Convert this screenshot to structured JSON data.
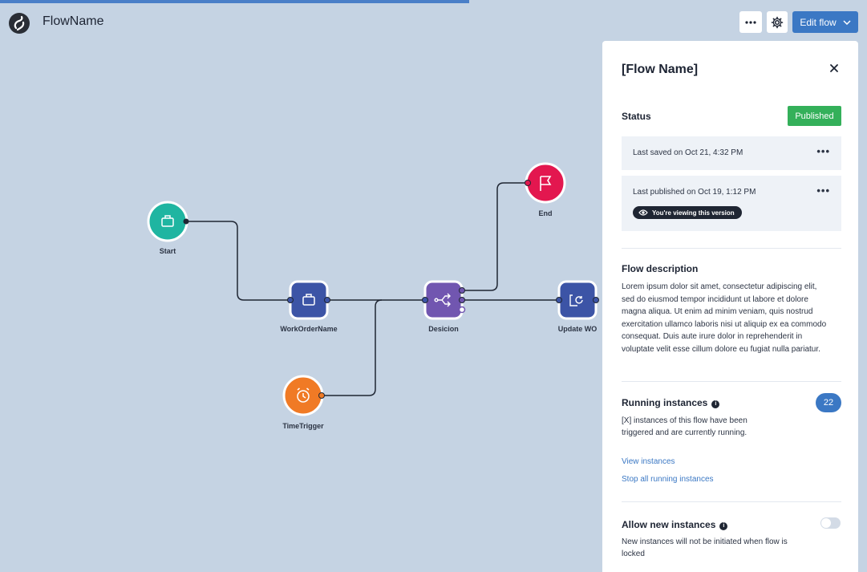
{
  "app": {
    "title": "FlowName"
  },
  "header": {
    "edit_label": "Edit flow"
  },
  "colors": {
    "canvas_bg": "#c5d3e3",
    "accent": "#3b78c4",
    "start": "#1fb5a1",
    "task": "#3c54a6",
    "decision": "#7156b0",
    "end": "#e3174f",
    "timer": "#f07a25",
    "published": "#34b05a"
  },
  "flow": {
    "nodes": {
      "start": {
        "label": "Start",
        "icon": "briefcase-icon"
      },
      "workorder": {
        "label": "WorkOrderName",
        "icon": "briefcase-icon"
      },
      "decision": {
        "label": "Desicion",
        "icon": "split-arrows-icon"
      },
      "update": {
        "label": "Update WO",
        "icon": "refresh-document-icon"
      },
      "end": {
        "label": "End",
        "icon": "flag-icon"
      },
      "timer": {
        "label": "TimeTrigger",
        "icon": "alarm-clock-icon"
      }
    }
  },
  "panel": {
    "title": "[Flow Name]",
    "status_label": "Status",
    "status_badge": "Published",
    "last_saved": "Last saved on Oct 21, 4:32 PM",
    "last_published": "Last published on Oct 19, 1:12 PM",
    "viewing_badge": "You're viewing this version",
    "description_title": "Flow description",
    "description": "Lorem ipsum dolor sit amet, consectetur adipiscing elit, sed do eiusmod tempor incididunt ut labore et dolore magna aliqua. Ut enim ad minim veniam, quis nostrud exercitation ullamco laboris nisi ut aliquip ex ea commodo consequat. Duis aute irure dolor in reprehenderit in voluptate velit esse cillum dolore eu fugiat nulla pariatur.",
    "running_title": "Running instances",
    "running_count": "22",
    "running_text": "[X] instances of this flow have been triggered and are currently running.",
    "view_instances": "View instances",
    "stop_instances": "Stop all running instances",
    "allow_title": "Allow new instances",
    "allow_text": "New instances will not be initiated when flow is locked",
    "allow_enabled": false
  }
}
